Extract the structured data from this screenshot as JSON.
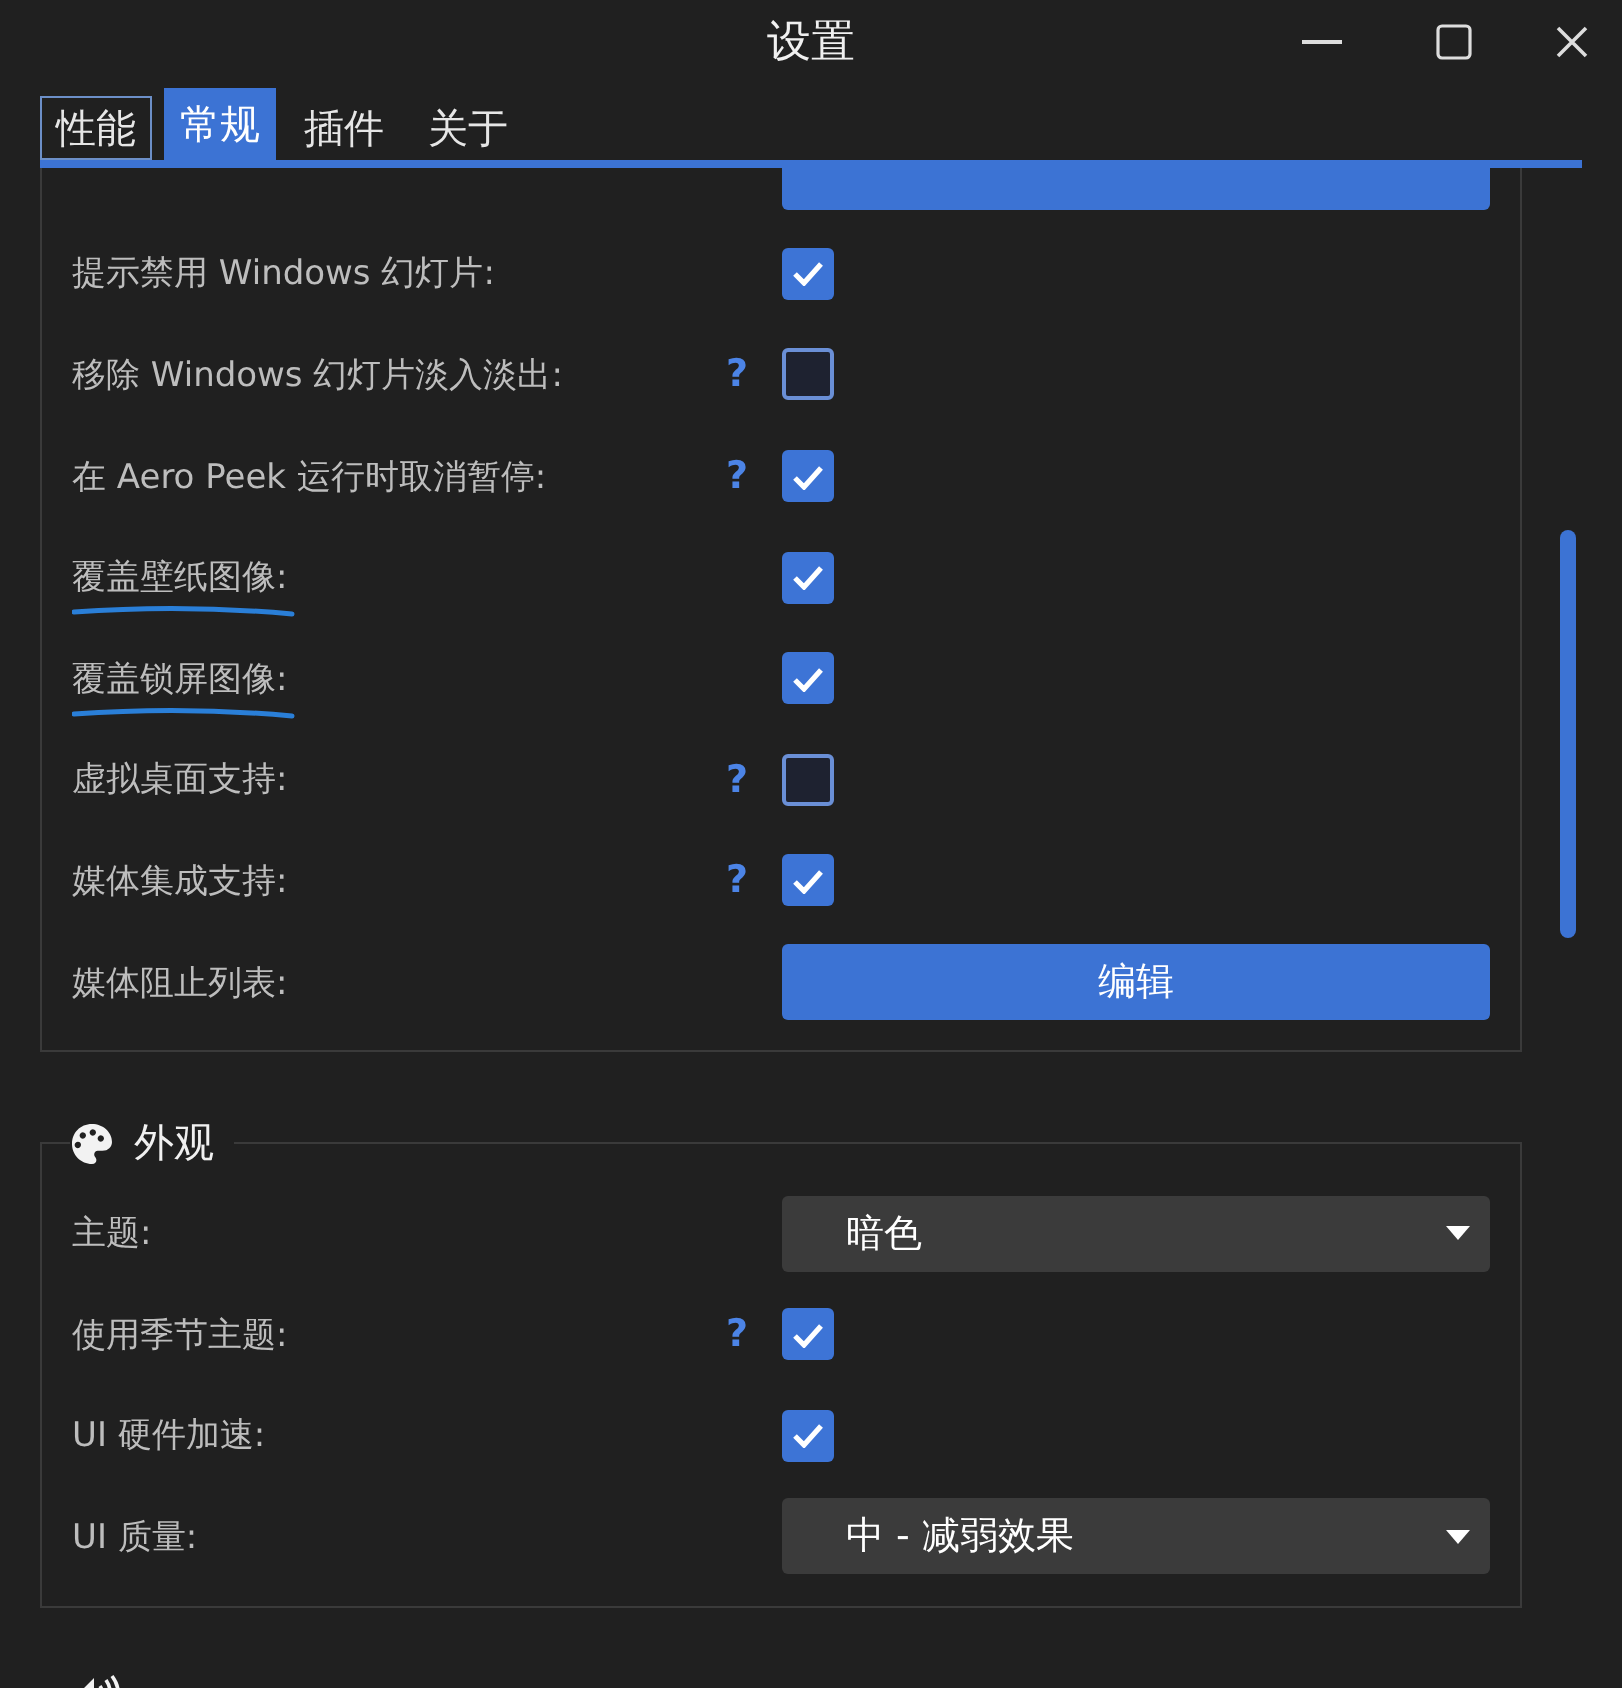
{
  "window": {
    "title": "设置"
  },
  "tabs": [
    {
      "label": "性能",
      "selected": false,
      "focused": true
    },
    {
      "label": "常规",
      "selected": true,
      "focused": false
    },
    {
      "label": "插件",
      "selected": false,
      "focused": false
    },
    {
      "label": "关于",
      "selected": false,
      "focused": false
    }
  ],
  "groups": [
    {
      "kind": "list",
      "rows": [
        {
          "kind": "button"
        },
        {
          "kind": "checkbox",
          "label": "提示禁用 Windows 幻灯片:",
          "checked": true
        },
        {
          "kind": "checkbox",
          "label": "移除 Windows 幻灯片淡入淡出:",
          "help": "?",
          "checked": false
        },
        {
          "kind": "checkbox",
          "label": "在 Aero Peek 运行时取消暂停:",
          "help": "?",
          "checked": true
        },
        {
          "kind": "checkbox",
          "label": "覆盖壁纸图像:",
          "checked": true,
          "underlined": true
        },
        {
          "kind": "checkbox",
          "label": "覆盖锁屏图像:",
          "checked": true,
          "underlined": true
        },
        {
          "kind": "checkbox",
          "label": "虚拟桌面支持:",
          "help": "?",
          "checked": false
        },
        {
          "kind": "checkbox",
          "label": "媒体集成支持:",
          "help": "?",
          "checked": true
        },
        {
          "kind": "button",
          "label": "媒体阻止列表:",
          "button": "编辑"
        }
      ]
    },
    {
      "kind": "section",
      "title": "外观",
      "rows": [
        {
          "kind": "dropdown",
          "label": "主题:",
          "value": "暗色"
        },
        {
          "kind": "checkbox",
          "label": "使用季节主题:",
          "help": "?",
          "checked": true
        },
        {
          "kind": "checkbox",
          "label": "UI 硬件加速:",
          "checked": true
        },
        {
          "kind": "dropdown",
          "label": "UI 质量:",
          "value": "中 - 减弱效果"
        }
      ]
    },
    {
      "kind": "section"
    }
  ]
}
